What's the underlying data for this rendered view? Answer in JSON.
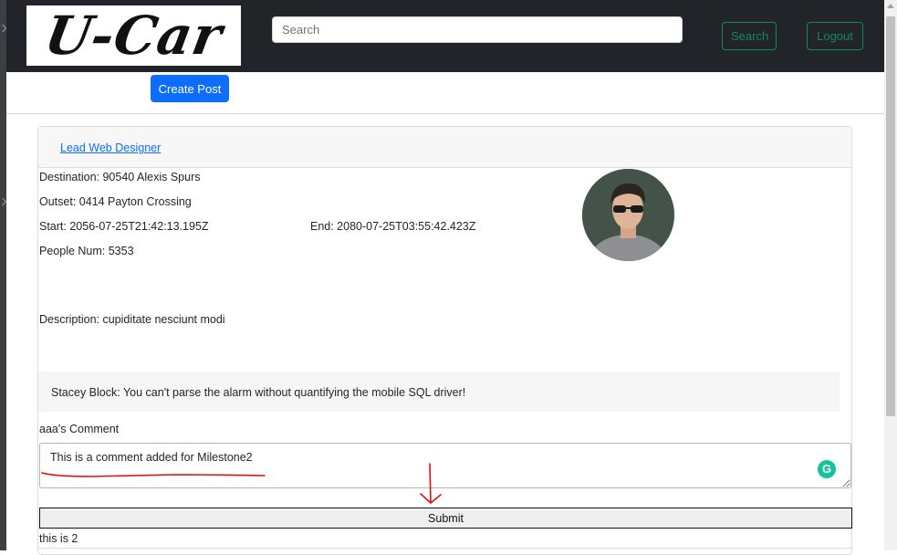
{
  "app": {
    "logo_text": "U-Car"
  },
  "navbar": {
    "search_placeholder": "Search",
    "search_label": "Search",
    "logout_label": "Logout"
  },
  "actions": {
    "create_post_label": "Create Post"
  },
  "post": {
    "title_link": "Lead Web Designer",
    "destination": "Destination: 90540 Alexis Spurs",
    "outset": "Outset: 0414 Payton Crossing",
    "start": "Start: 2056-07-25T21:42:13.195Z",
    "end": "End: 2080-07-25T03:55:42.423Z",
    "people": "People Num: 5353",
    "description": "Description: cupiditate nesciunt modi",
    "comment": "Stacey Block: You can't parse the alarm without quantifying the mobile SQL driver!",
    "comment_label": "aaa's Comment",
    "comment_input_value": "This is a comment added for Milestone2",
    "submit_label": "Submit",
    "footer_text": "this is 2"
  },
  "colors": {
    "navbar_bg": "#212529",
    "primary": "#0d6efd",
    "success": "#198754",
    "annotation": "#e01010",
    "grammarly": "#15c39a"
  }
}
